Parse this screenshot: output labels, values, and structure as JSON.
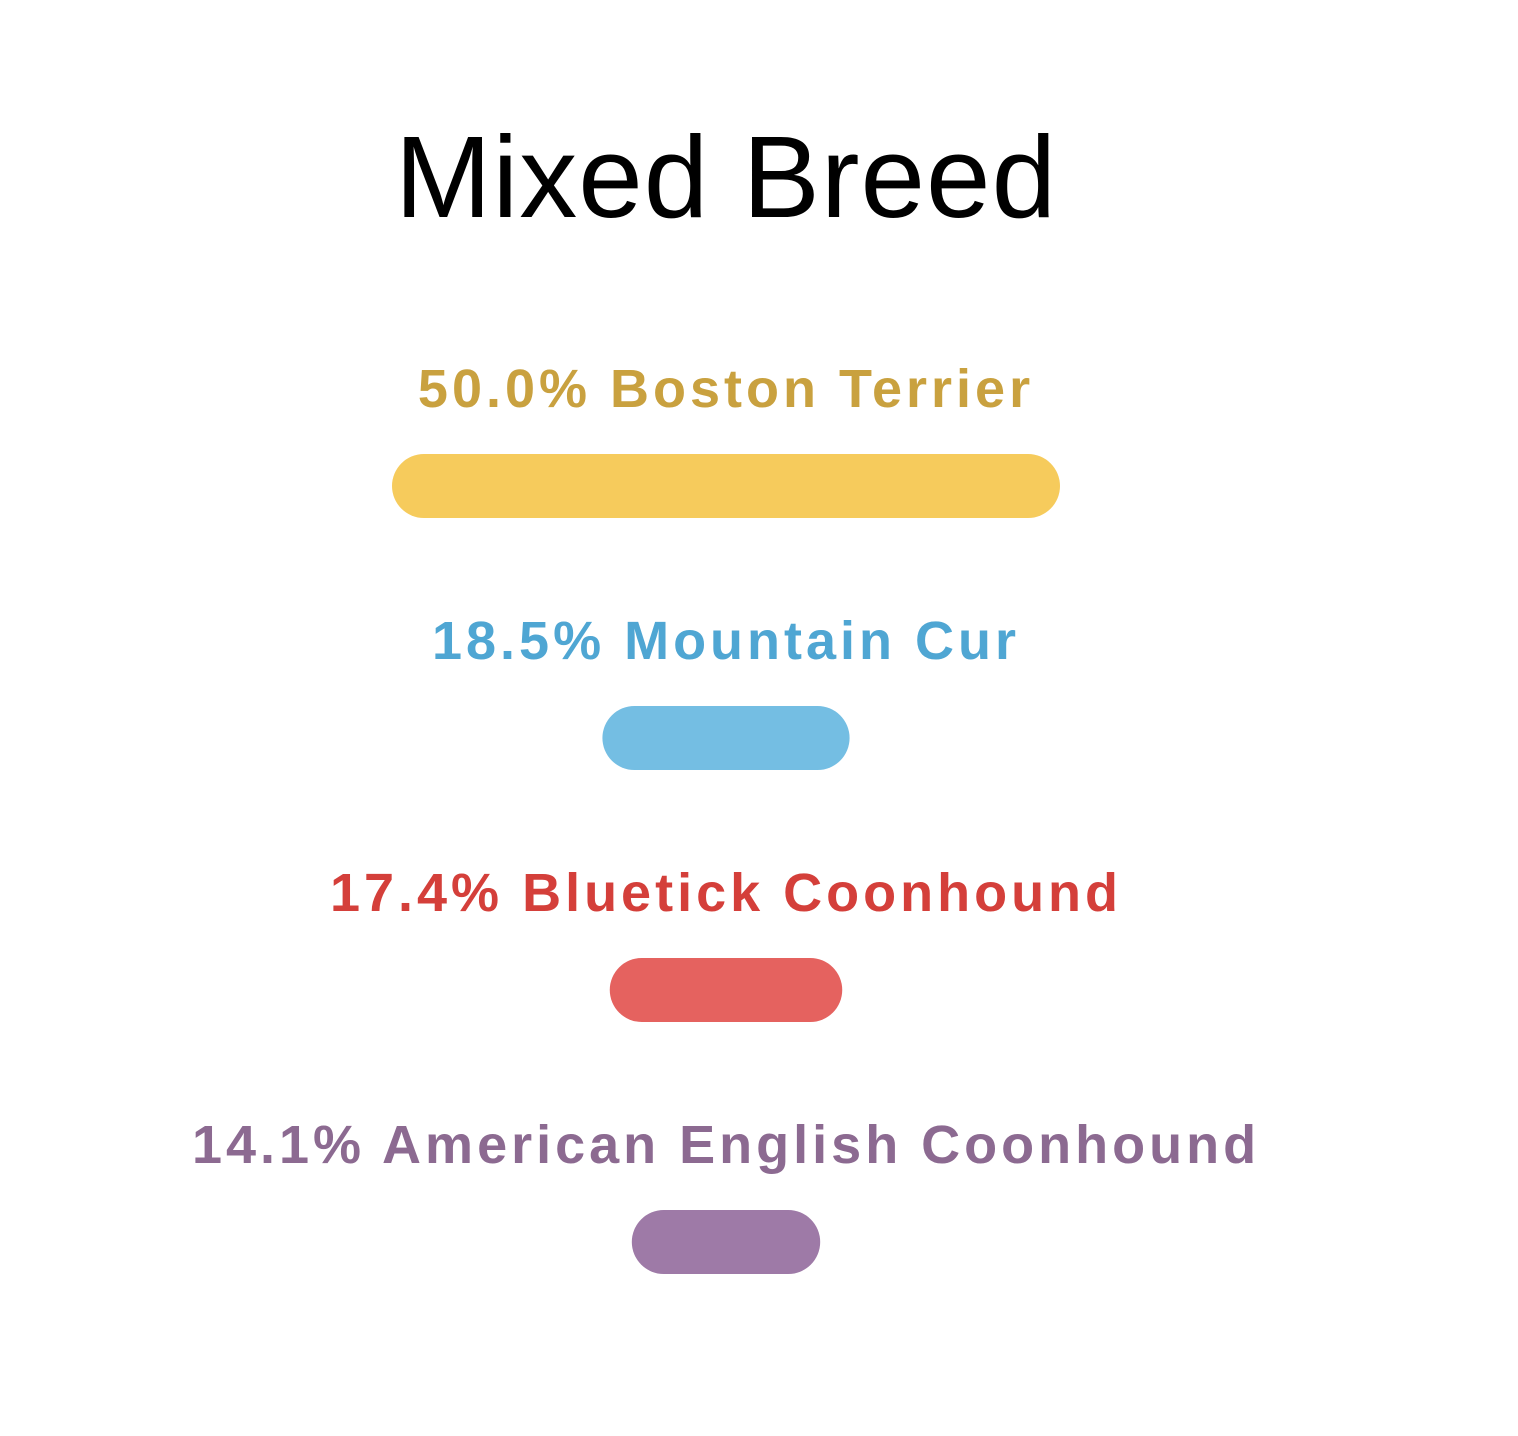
{
  "title": "Mixed Breed",
  "chart_data": {
    "type": "bar",
    "title": "Mixed Breed",
    "xlabel": "",
    "ylabel": "",
    "grid": false,
    "categories": [
      "Boston Terrier",
      "Mountain Cur",
      "Bluetick Coonhound",
      "American English Coonhound"
    ],
    "values": [
      50.0,
      18.5,
      17.4,
      14.1
    ],
    "labels": [
      "50.0% Boston Terrier",
      "18.5% Mountain Cur",
      "17.4% Bluetick Coonhound",
      "14.1% American English Coonhound"
    ],
    "label_colors": [
      "#c9a13f",
      "#4fa6d3",
      "#d43f3a",
      "#8c6a91"
    ],
    "bar_colors": [
      "#f6cb5c",
      "#74bee3",
      "#e5625f",
      "#9e7aa7"
    ]
  }
}
